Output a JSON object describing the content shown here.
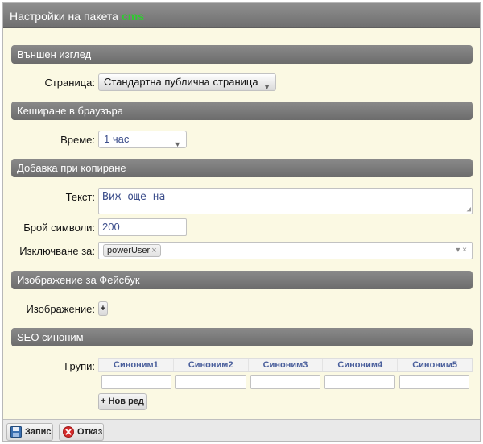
{
  "header": {
    "title": "Настройки на пакета",
    "package": "cms"
  },
  "sections": {
    "appearance": "Външен изглед",
    "cache": "Кеширане в браузъра",
    "copy": "Добавка при копиране",
    "facebook": "Изображение за Фейсбук",
    "seo": "SEO синоним"
  },
  "fields": {
    "page": {
      "label": "Страница:",
      "value": "Стандартна публична страница"
    },
    "time": {
      "label": "Време:",
      "value": "1 час"
    },
    "text": {
      "label": "Текст:",
      "value": "Виж още на"
    },
    "char_count": {
      "label": "Брой символи:",
      "value": "200"
    },
    "exclude": {
      "label": "Изключване за:",
      "tag": "powerUser",
      "tag_remove": "×",
      "controls": "▾ ×"
    },
    "image": {
      "label": "Изображение:",
      "add": "+"
    },
    "groups": {
      "label": "Групи:",
      "columns": [
        "Синоним1",
        "Синоним2",
        "Синоним3",
        "Синоним4",
        "Синоним5"
      ],
      "new_row": "+ Нов ред"
    }
  },
  "footer": {
    "save": "Запис",
    "cancel": "Отказ"
  },
  "colors": {
    "accent_green": "#2ecc2e",
    "field_text": "#3d4f8c",
    "panel_bg": "#fbf9e3"
  }
}
